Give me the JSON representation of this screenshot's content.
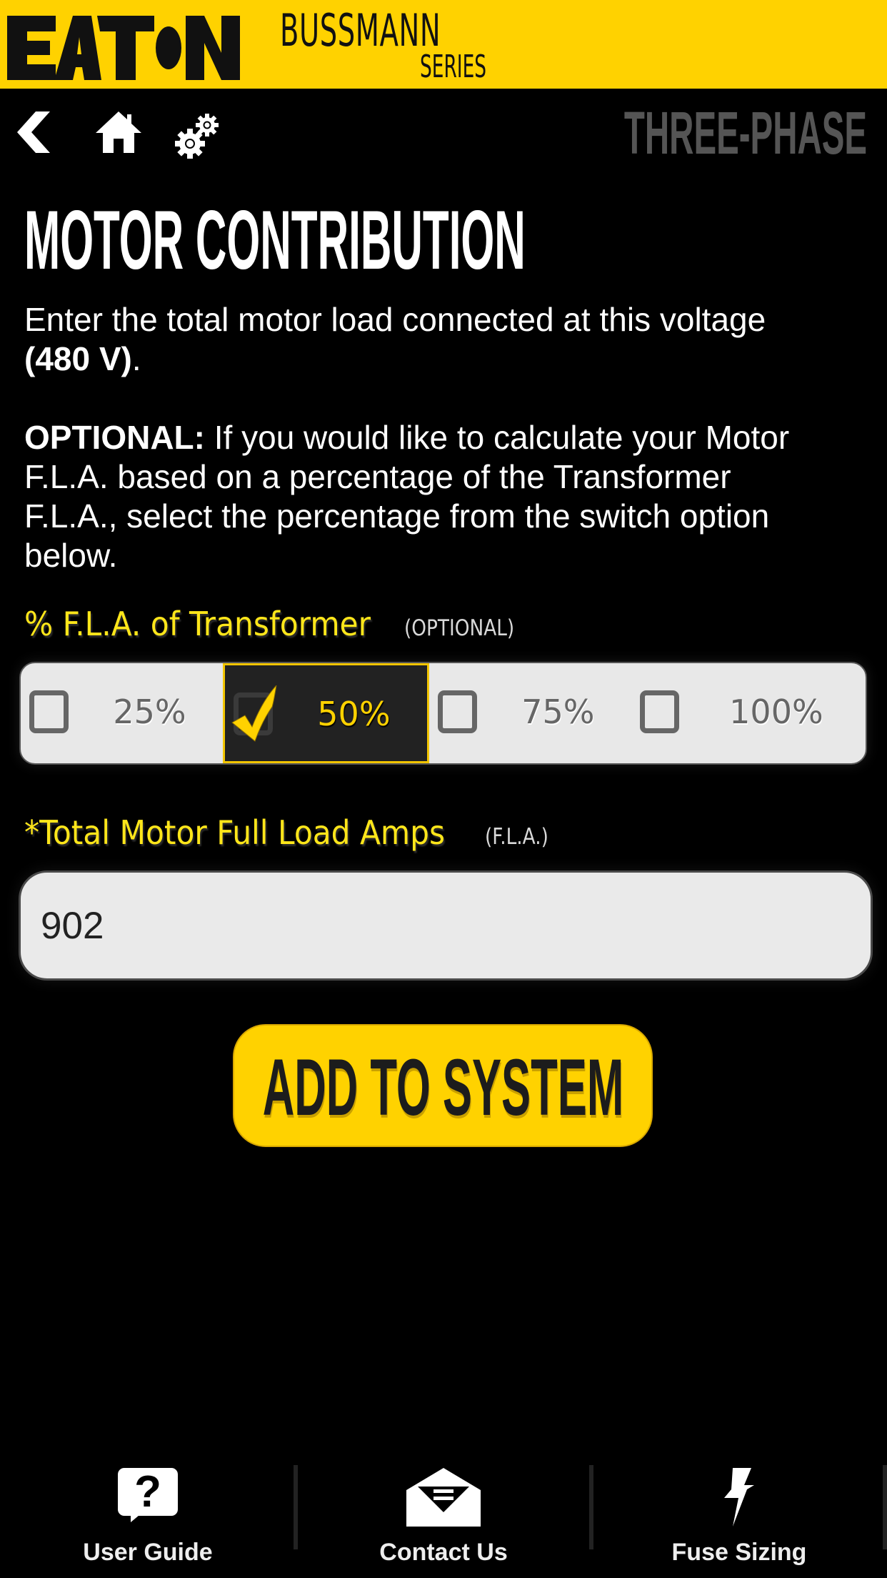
{
  "brand": {
    "logo_name": "EATON",
    "product_line": "BUSSMANN",
    "product_series": "SERIES",
    "header_color": "#FFD200"
  },
  "nav": {
    "icons": [
      "back-icon",
      "home-icon",
      "settings-icon"
    ],
    "mode_label": "THREE-PHASE"
  },
  "page": {
    "title": "MOTOR CONTRIBUTION",
    "intro_lines": [
      {
        "text": "Enter the total motor load connected at this voltage"
      },
      {
        "bold": "(480 V)",
        "text": "."
      }
    ],
    "optional_lines": [
      {
        "bold": "OPTIONAL:",
        "text": " If you would like to calculate your Motor"
      },
      {
        "text": "F.L.A. based on a percentage of the Transformer"
      },
      {
        "text": "F.L.A., select the percentage from the switch option"
      },
      {
        "text": "below."
      }
    ]
  },
  "percent_switch": {
    "label": "% F.L.A. of Transformer",
    "sublabel": "(OPTIONAL)",
    "options": [
      {
        "label": "25%",
        "selected": false
      },
      {
        "label": "50%",
        "selected": true
      },
      {
        "label": "75%",
        "selected": false
      },
      {
        "label": "100%",
        "selected": false
      }
    ],
    "selected_value": "50%"
  },
  "motor_fla": {
    "label": "*Total Motor Full Load Amps",
    "sublabel": "(F.L.A.)",
    "value": "902"
  },
  "actions": {
    "add_label": "ADD TO SYSTEM"
  },
  "bottom_nav": {
    "items": [
      {
        "label": "User Guide",
        "icon": "help-bubble-icon"
      },
      {
        "label": "Contact Us",
        "icon": "envelope-icon"
      },
      {
        "label": "Fuse Sizing",
        "icon": "lightning-bolt-icon"
      }
    ]
  },
  "colors": {
    "accent_yellow": "#FFD200",
    "label_yellow": "#FFE61A",
    "mode_label_gray": "#555555",
    "background": "#000000"
  }
}
